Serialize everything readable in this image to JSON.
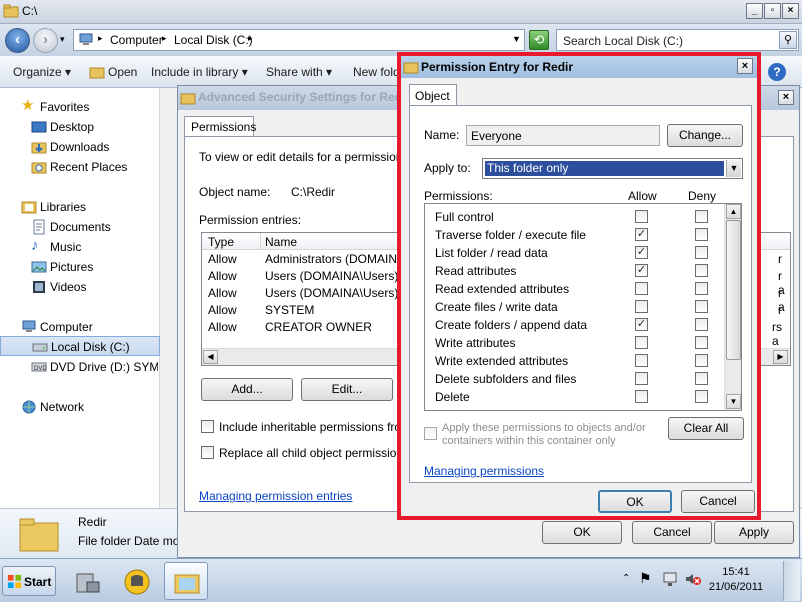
{
  "explorer": {
    "title": "C:\\",
    "address": {
      "crumbs": [
        "Computer",
        "Local Disk (C:)"
      ]
    },
    "search_placeholder": "Search Local Disk (C:)",
    "toolbar": [
      "Organize",
      "Open",
      "Include in library",
      "Share with",
      "New folder"
    ],
    "nav": {
      "favorites_label": "Favorites",
      "favorites": [
        "Desktop",
        "Downloads",
        "Recent Places"
      ],
      "libraries_label": "Libraries",
      "libraries": [
        "Documents",
        "Music",
        "Pictures",
        "Videos"
      ],
      "computer_label": "Computer",
      "computer_items": [
        "Local Disk (C:)",
        "DVD Drive (D:) SYMAN"
      ],
      "network_label": "Network"
    },
    "details": {
      "name": "Redir",
      "type_text": "File folder Date modi"
    }
  },
  "advanced": {
    "title": "Advanced Security Settings for Redir",
    "tab": "Permissions",
    "intro": "To view or edit details for a permission entry, select the entry and then click Edit.",
    "object_name_label": "Object name:",
    "object_name": "C:\\Redir",
    "entries_label": "Permission entries:",
    "columns": [
      "Type",
      "Name"
    ],
    "rows": [
      {
        "type": "Allow",
        "name": "Administrators (DOMAINA\\Administrators)"
      },
      {
        "type": "Allow",
        "name": "Users (DOMAINA\\Users)"
      },
      {
        "type": "Allow",
        "name": "Users (DOMAINA\\Users)"
      },
      {
        "type": "Allow",
        "name": "SYSTEM"
      },
      {
        "type": "Allow",
        "name": "CREATOR OWNER"
      }
    ],
    "right_fragments": [
      "r",
      "r a",
      "r a",
      "r",
      "rs a"
    ],
    "add_label": "Add...",
    "edit_label": "Edit...",
    "include_inheritable": "Include inheritable permissions from this object's parent",
    "replace_child": "Replace all child object permissions with inheritable permissions from this object",
    "manage_link": "Managing permission entries",
    "ok": "OK",
    "cancel": "Cancel",
    "apply": "Apply"
  },
  "perm": {
    "title": "Permission Entry for Redir",
    "tab": "Object",
    "name_label": "Name:",
    "name_value": "Everyone",
    "change_label": "Change...",
    "apply_to_label": "Apply to:",
    "apply_to_value": "This folder only",
    "permissions_label": "Permissions:",
    "allow_header": "Allow",
    "deny_header": "Deny",
    "permissions": [
      {
        "label": "Full control",
        "allow": false,
        "deny": false
      },
      {
        "label": "Traverse folder / execute file",
        "allow": true,
        "deny": false
      },
      {
        "label": "List folder / read data",
        "allow": true,
        "deny": false
      },
      {
        "label": "Read attributes",
        "allow": true,
        "deny": false
      },
      {
        "label": "Read extended attributes",
        "allow": false,
        "deny": false
      },
      {
        "label": "Create files / write data",
        "allow": false,
        "deny": false
      },
      {
        "label": "Create folders / append data",
        "allow": true,
        "deny": false
      },
      {
        "label": "Write attributes",
        "allow": false,
        "deny": false
      },
      {
        "label": "Write extended attributes",
        "allow": false,
        "deny": false
      },
      {
        "label": "Delete subfolders and files",
        "allow": false,
        "deny": false
      },
      {
        "label": "Delete",
        "allow": false,
        "deny": false
      }
    ],
    "apply_objects_label": "Apply these permissions to objects and/or containers within this container only",
    "clear_all_label": "Clear All",
    "manage_link": "Managing permissions",
    "ok": "OK",
    "cancel": "Cancel"
  },
  "taskbar": {
    "start_label": "Start",
    "time": "15:41",
    "date": "21/06/2011"
  },
  "colors": {
    "highlight_border": "#e8192c",
    "selection": "#2c4e9c"
  }
}
